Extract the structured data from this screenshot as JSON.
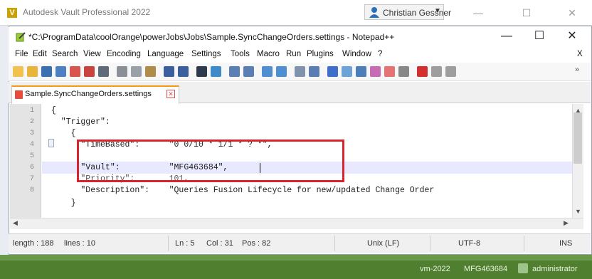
{
  "vault": {
    "title": "Autodesk Vault Professional 2022",
    "user": "Christian Gessner",
    "status": {
      "server": "vm-2022",
      "vault_name": "MFG463684",
      "user": "administrator"
    }
  },
  "notepad": {
    "title": "*C:\\ProgramData\\coolOrange\\powerJobs\\Jobs\\Sample.SyncChangeOrders.settings - Notepad++",
    "menu": [
      "File",
      "Edit",
      "Search",
      "View",
      "Encoding",
      "Language",
      "Settings",
      "Tools",
      "Macro",
      "Run",
      "Plugins",
      "Window",
      "?"
    ],
    "menu_close": "X",
    "tab": "Sample.SyncChangeOrders.settings",
    "lines": [
      {
        "n": "1",
        "text": "{"
      },
      {
        "n": "2",
        "text": "  \"Trigger\":"
      },
      {
        "n": "3",
        "text": "    {"
      },
      {
        "n": "4",
        "text": "      \"TimeBased\":      \"0 0/10 * 1/1 * ? *\","
      },
      {
        "n": "5",
        "text": "      \"Vault\":          \"MFG463684\","
      },
      {
        "n": "6",
        "text": "      \"Priority\":       101,"
      },
      {
        "n": "7",
        "text": "      \"Description\":    \"Queries Fusion Lifecycle for new/updated Change Order"
      },
      {
        "n": "8",
        "text": "    }"
      }
    ],
    "status": {
      "length": "length : 188",
      "lines": "lines : 10",
      "ln": "Ln : 5",
      "col": "Col : 31",
      "pos": "Pos : 82",
      "eol": "Unix (LF)",
      "encoding": "UTF-8",
      "mode": "INS"
    }
  },
  "colors": {
    "highlight_box": "#d9232d",
    "vault_status_bar": "#4f7f2f"
  },
  "icons": [
    "vault-logo-icon",
    "user-icon",
    "notepadpp-icon",
    "file-tab-icon",
    "tab-close-icon",
    "toolbar-icons"
  ]
}
